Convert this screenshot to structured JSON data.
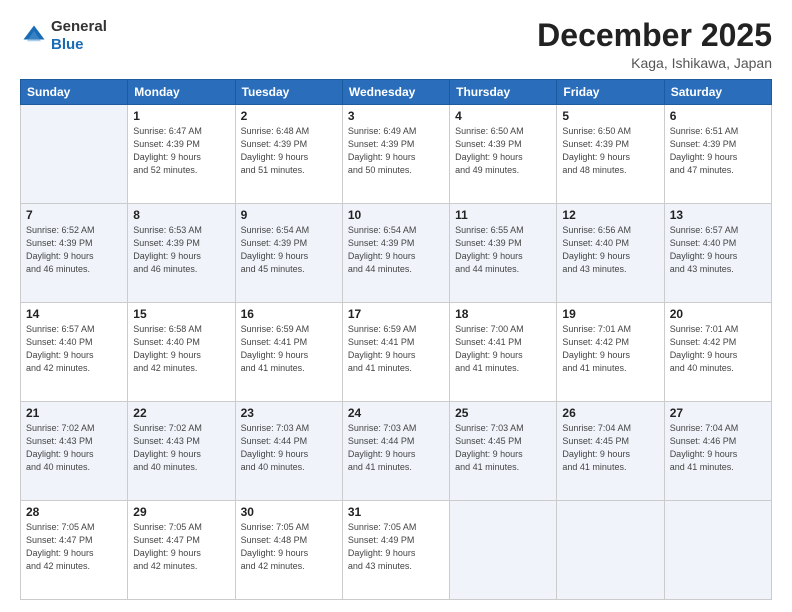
{
  "header": {
    "logo": {
      "general": "General",
      "blue": "Blue"
    },
    "title": "December 2025",
    "location": "Kaga, Ishikawa, Japan"
  },
  "days_of_week": [
    "Sunday",
    "Monday",
    "Tuesday",
    "Wednesday",
    "Thursday",
    "Friday",
    "Saturday"
  ],
  "weeks": [
    [
      {
        "day": "",
        "info": ""
      },
      {
        "day": "1",
        "info": "Sunrise: 6:47 AM\nSunset: 4:39 PM\nDaylight: 9 hours\nand 52 minutes."
      },
      {
        "day": "2",
        "info": "Sunrise: 6:48 AM\nSunset: 4:39 PM\nDaylight: 9 hours\nand 51 minutes."
      },
      {
        "day": "3",
        "info": "Sunrise: 6:49 AM\nSunset: 4:39 PM\nDaylight: 9 hours\nand 50 minutes."
      },
      {
        "day": "4",
        "info": "Sunrise: 6:50 AM\nSunset: 4:39 PM\nDaylight: 9 hours\nand 49 minutes."
      },
      {
        "day": "5",
        "info": "Sunrise: 6:50 AM\nSunset: 4:39 PM\nDaylight: 9 hours\nand 48 minutes."
      },
      {
        "day": "6",
        "info": "Sunrise: 6:51 AM\nSunset: 4:39 PM\nDaylight: 9 hours\nand 47 minutes."
      }
    ],
    [
      {
        "day": "7",
        "info": "Sunrise: 6:52 AM\nSunset: 4:39 PM\nDaylight: 9 hours\nand 46 minutes."
      },
      {
        "day": "8",
        "info": "Sunrise: 6:53 AM\nSunset: 4:39 PM\nDaylight: 9 hours\nand 46 minutes."
      },
      {
        "day": "9",
        "info": "Sunrise: 6:54 AM\nSunset: 4:39 PM\nDaylight: 9 hours\nand 45 minutes."
      },
      {
        "day": "10",
        "info": "Sunrise: 6:54 AM\nSunset: 4:39 PM\nDaylight: 9 hours\nand 44 minutes."
      },
      {
        "day": "11",
        "info": "Sunrise: 6:55 AM\nSunset: 4:39 PM\nDaylight: 9 hours\nand 44 minutes."
      },
      {
        "day": "12",
        "info": "Sunrise: 6:56 AM\nSunset: 4:40 PM\nDaylight: 9 hours\nand 43 minutes."
      },
      {
        "day": "13",
        "info": "Sunrise: 6:57 AM\nSunset: 4:40 PM\nDaylight: 9 hours\nand 43 minutes."
      }
    ],
    [
      {
        "day": "14",
        "info": "Sunrise: 6:57 AM\nSunset: 4:40 PM\nDaylight: 9 hours\nand 42 minutes."
      },
      {
        "day": "15",
        "info": "Sunrise: 6:58 AM\nSunset: 4:40 PM\nDaylight: 9 hours\nand 42 minutes."
      },
      {
        "day": "16",
        "info": "Sunrise: 6:59 AM\nSunset: 4:41 PM\nDaylight: 9 hours\nand 41 minutes."
      },
      {
        "day": "17",
        "info": "Sunrise: 6:59 AM\nSunset: 4:41 PM\nDaylight: 9 hours\nand 41 minutes."
      },
      {
        "day": "18",
        "info": "Sunrise: 7:00 AM\nSunset: 4:41 PM\nDaylight: 9 hours\nand 41 minutes."
      },
      {
        "day": "19",
        "info": "Sunrise: 7:01 AM\nSunset: 4:42 PM\nDaylight: 9 hours\nand 41 minutes."
      },
      {
        "day": "20",
        "info": "Sunrise: 7:01 AM\nSunset: 4:42 PM\nDaylight: 9 hours\nand 40 minutes."
      }
    ],
    [
      {
        "day": "21",
        "info": "Sunrise: 7:02 AM\nSunset: 4:43 PM\nDaylight: 9 hours\nand 40 minutes."
      },
      {
        "day": "22",
        "info": "Sunrise: 7:02 AM\nSunset: 4:43 PM\nDaylight: 9 hours\nand 40 minutes."
      },
      {
        "day": "23",
        "info": "Sunrise: 7:03 AM\nSunset: 4:44 PM\nDaylight: 9 hours\nand 40 minutes."
      },
      {
        "day": "24",
        "info": "Sunrise: 7:03 AM\nSunset: 4:44 PM\nDaylight: 9 hours\nand 41 minutes."
      },
      {
        "day": "25",
        "info": "Sunrise: 7:03 AM\nSunset: 4:45 PM\nDaylight: 9 hours\nand 41 minutes."
      },
      {
        "day": "26",
        "info": "Sunrise: 7:04 AM\nSunset: 4:45 PM\nDaylight: 9 hours\nand 41 minutes."
      },
      {
        "day": "27",
        "info": "Sunrise: 7:04 AM\nSunset: 4:46 PM\nDaylight: 9 hours\nand 41 minutes."
      }
    ],
    [
      {
        "day": "28",
        "info": "Sunrise: 7:05 AM\nSunset: 4:47 PM\nDaylight: 9 hours\nand 42 minutes."
      },
      {
        "day": "29",
        "info": "Sunrise: 7:05 AM\nSunset: 4:47 PM\nDaylight: 9 hours\nand 42 minutes."
      },
      {
        "day": "30",
        "info": "Sunrise: 7:05 AM\nSunset: 4:48 PM\nDaylight: 9 hours\nand 42 minutes."
      },
      {
        "day": "31",
        "info": "Sunrise: 7:05 AM\nSunset: 4:49 PM\nDaylight: 9 hours\nand 43 minutes."
      },
      {
        "day": "",
        "info": ""
      },
      {
        "day": "",
        "info": ""
      },
      {
        "day": "",
        "info": ""
      }
    ]
  ]
}
